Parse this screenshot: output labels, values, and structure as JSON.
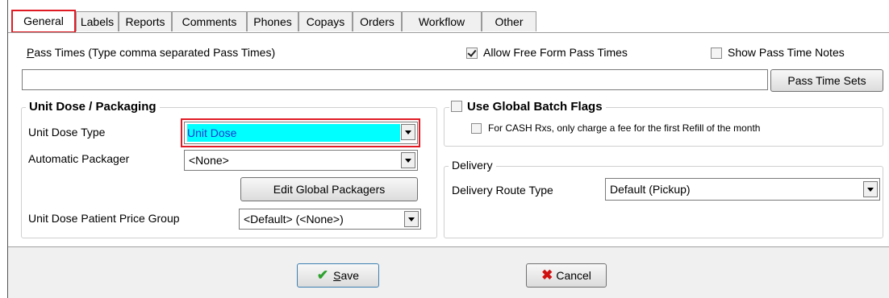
{
  "tabs": [
    {
      "label": "General",
      "active": true
    },
    {
      "label": "Labels"
    },
    {
      "label": "Reports"
    },
    {
      "label": "Comments"
    },
    {
      "label": "Phones"
    },
    {
      "label": "Copays"
    },
    {
      "label": "Orders"
    },
    {
      "label": "Workflow"
    },
    {
      "label": "Other"
    }
  ],
  "pass_times": {
    "label_rest": "ass Times (Type comma separated Pass Times)",
    "label_mnemonic": "P",
    "value": "",
    "allow_free_form": {
      "label": "Allow Free Form Pass Times",
      "checked": true
    },
    "show_notes": {
      "label": "Show Pass Time Notes",
      "checked": false
    },
    "sets_button": "Pass Time Sets"
  },
  "unit_dose": {
    "group_title": "Unit Dose / Packaging",
    "type_label": "Unit Dose Type",
    "type_value": "Unit Dose",
    "packager_label": "Automatic Packager",
    "packager_value": "<None>",
    "edit_button": "Edit Global Packagers",
    "price_group_label": "Unit Dose Patient Price Group",
    "price_group_value": "<Default> (<None>)"
  },
  "batch_flags": {
    "label": "Use Global Batch Flags",
    "checked": false,
    "cash_label": "For CASH Rxs, only charge a fee for the first Refill of the month",
    "cash_checked": false
  },
  "delivery": {
    "group_title": "Delivery",
    "route_label": "Delivery Route Type",
    "route_value": "Default (Pickup)"
  },
  "footer": {
    "save_mnemonic": "S",
    "save_rest": "ave",
    "cancel_label": "Cancel"
  },
  "colors": {
    "highlight": "#00ffff",
    "highlight_text": "#1a3bd1",
    "callout": "#e01b24",
    "check_green": "#2ea12e",
    "cancel_red": "#d01010"
  }
}
